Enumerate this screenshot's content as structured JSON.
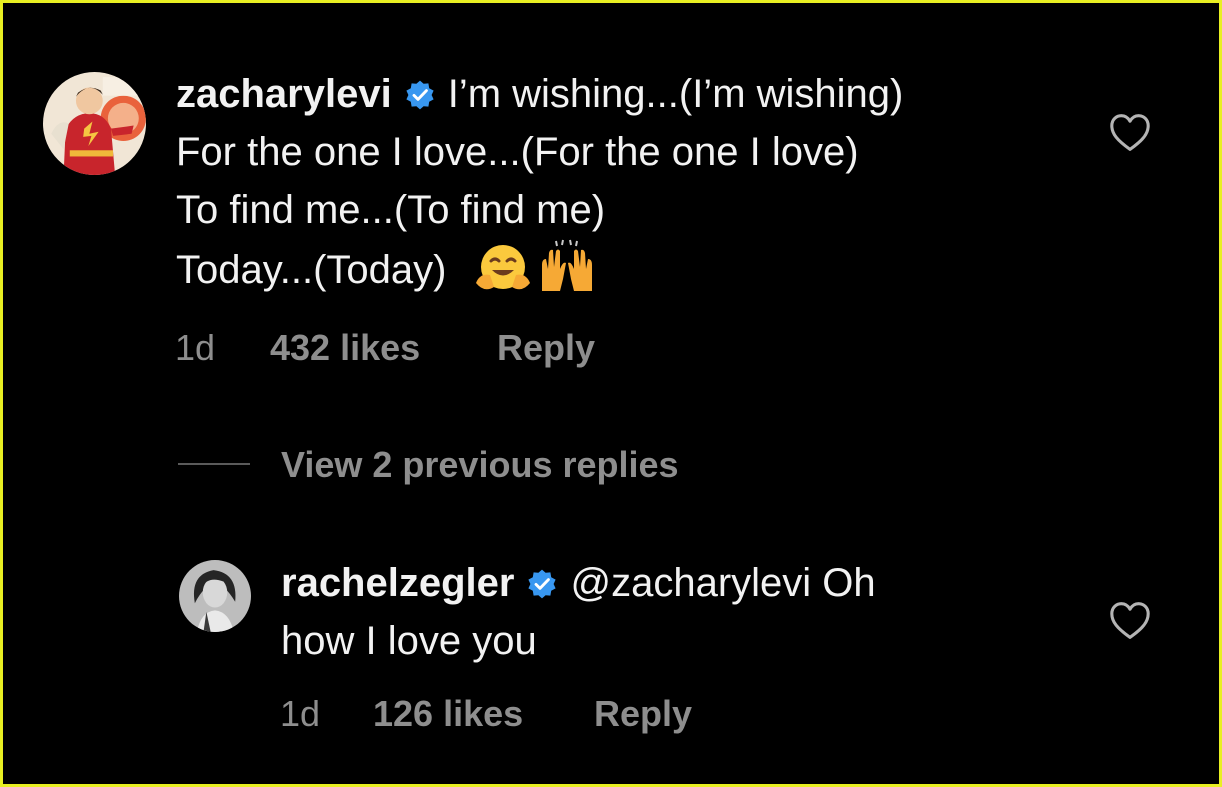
{
  "comments": [
    {
      "username": "zacharylevi",
      "lines": [
        "I’m wishing...(I’m wishing)",
        "For the one I love...(For the one I love)",
        "To find me...(To find me)",
        "Today...(Today)"
      ],
      "emojis": [
        "hugging-face-emoji",
        "raising-hands-emoji"
      ],
      "time": "1d",
      "likes": "432 likes",
      "reply": "Reply"
    },
    {
      "username": "rachelzegler",
      "lines": [
        "@zacharylevi Oh",
        "how I love you"
      ],
      "time": "1d",
      "likes": "126 likes",
      "reply": "Reply"
    }
  ],
  "view_replies": "View 2 previous replies",
  "icons": {
    "verified": "verified-badge-icon",
    "like": "heart-outline-icon"
  },
  "colors": {
    "background": "#000000",
    "text": "#f2f2f2",
    "muted": "#8e8e8e",
    "verified": "#3897f0",
    "frame": "#e8ef22"
  }
}
